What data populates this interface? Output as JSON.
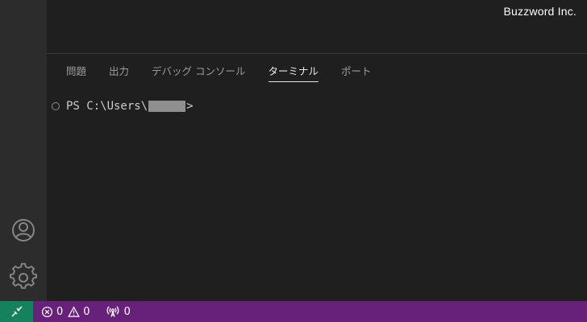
{
  "watermark": "Buzzword Inc.",
  "activity_bar": {
    "accounts_icon": "account-icon",
    "manage_icon": "gear-icon"
  },
  "panel": {
    "tabs": [
      {
        "label": "問題",
        "active": false
      },
      {
        "label": "出力",
        "active": false
      },
      {
        "label": "デバッグ コンソール",
        "active": false
      },
      {
        "label": "ターミナル",
        "active": true
      },
      {
        "label": "ポート",
        "active": false
      }
    ]
  },
  "terminal": {
    "prompt_prefix": "PS C:\\Users\\",
    "prompt_suffix": ">"
  },
  "statusbar": {
    "remote_icon": "remote-icon",
    "errors": "0",
    "warnings": "0",
    "ports": "0",
    "colors": {
      "background": "#68217a",
      "remote_background": "#16825d"
    }
  }
}
